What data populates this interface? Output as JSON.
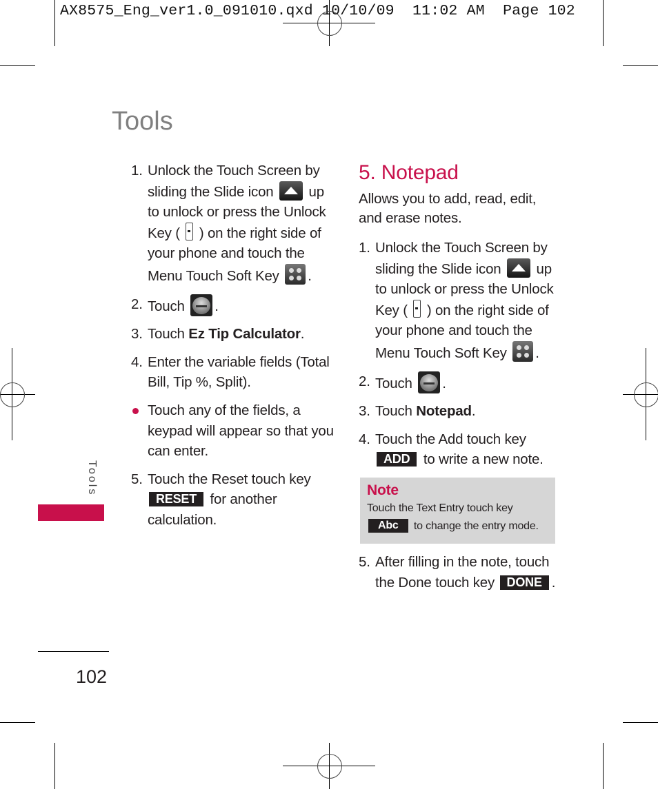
{
  "slug": {
    "filename": "AX8575_Eng_ver1.0_091010.qxd",
    "date": "10/10/09",
    "time": "11:02 AM",
    "page_label": "Page 102"
  },
  "page_title": "Tools",
  "side_tab": "Tools",
  "page_number": "102",
  "colors": {
    "accent": "#c8104b",
    "note_bg": "#d6d6d6",
    "key_bg": "#231f20",
    "title_gray": "#808080"
  },
  "left_column": {
    "step1": {
      "num": "1.",
      "part1": "Unlock the Touch Screen by sliding the Slide icon",
      "part2": "up to unlock or press the Unlock Key (",
      "part3": ") on the right side of your phone and touch the Menu Touch Soft Key",
      "part4": ".",
      "icons": [
        "slide-up-icon",
        "unlock-key-icon",
        "menu-icon"
      ]
    },
    "step2": {
      "num": "2.",
      "text": "Touch",
      "after": ".",
      "icon": "tools-icon"
    },
    "step3": {
      "num": "3.",
      "text": "Touch",
      "bold": "Ez Tip Calculator",
      "after": "."
    },
    "step4": {
      "num": "4.",
      "text": "Enter the variable fields (Total Bill, Tip %, Split)."
    },
    "bullet": {
      "text": "Touch any of the fields, a keypad will appear so that you can enter."
    },
    "step5": {
      "num": "5.",
      "text": "Touch the Reset touch key",
      "key": "RESET",
      "after": "for another calculation."
    }
  },
  "right_column": {
    "section_title": "5. Notepad",
    "intro": "Allows you to add, read, edit, and erase notes.",
    "step1": {
      "num": "1.",
      "part1": "Unlock the Touch Screen by sliding the Slide icon",
      "part2": "up to unlock or press the Unlock Key (",
      "part3": ") on the right side of your phone and touch the Menu Touch Soft Key",
      "part4": "."
    },
    "step2": {
      "num": "2.",
      "text": "Touch",
      "after": "."
    },
    "step3": {
      "num": "3.",
      "text": "Touch",
      "bold": "Notepad",
      "after": "."
    },
    "step4": {
      "num": "4.",
      "text": "Touch the Add touch key",
      "key": "ADD",
      "after": "to write a new note."
    },
    "note": {
      "title": "Note",
      "text": "Touch the Text Entry touch key",
      "key": "Abc",
      "after": "to change the entry mode."
    },
    "step5": {
      "num": "5.",
      "text": "After filling in the note, touch the Done touch key",
      "key": "DONE",
      "after": "."
    }
  }
}
